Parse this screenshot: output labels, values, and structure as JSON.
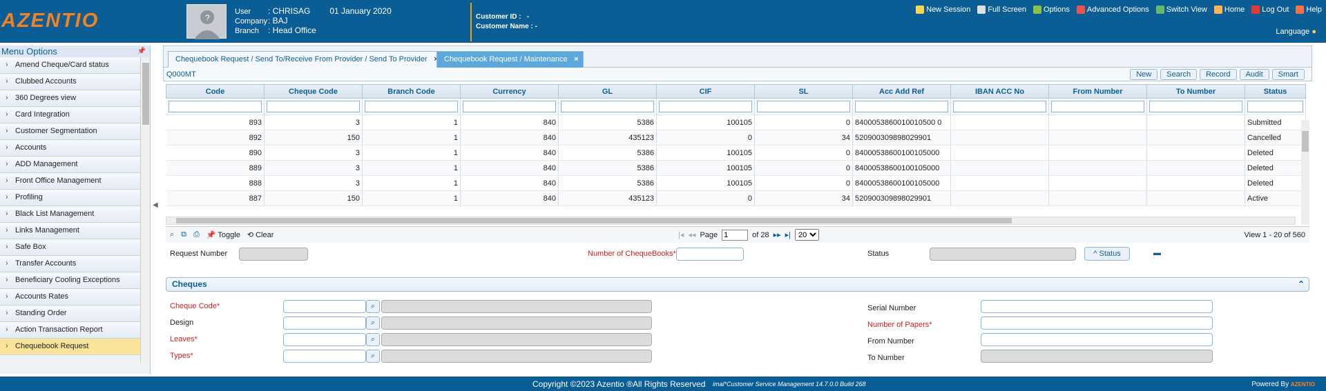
{
  "header": {
    "logo": "AZENTIO",
    "user_lbl": "User",
    "user": "CHRISAG",
    "date": "01 January 2020",
    "company_lbl": "Company",
    "company": "BAJ",
    "branch_lbl": "Branch",
    "branch": "Head Office",
    "custid_lbl": "Customer ID",
    "custid": "-",
    "custname_lbl": "Customer Name",
    "custname": "-",
    "toolbar": [
      {
        "label": "New Session",
        "icon": "new-session-icon",
        "color": "#ffd54f"
      },
      {
        "label": "Full Screen",
        "icon": "fullscreen-icon",
        "color": "#e0e0e0"
      },
      {
        "label": "Options",
        "icon": "options-icon",
        "color": "#8bc34a"
      },
      {
        "label": "Advanced Options",
        "icon": "advanced-options-icon",
        "color": "#ef5350"
      },
      {
        "label": "Switch View",
        "icon": "switch-view-icon",
        "color": "#66bb6a"
      },
      {
        "label": "Home",
        "icon": "home-icon",
        "color": "#ffb74d"
      },
      {
        "label": "Log Out",
        "icon": "logout-icon",
        "color": "#e53935"
      },
      {
        "label": "Help",
        "icon": "help-icon",
        "color": "#ff7043"
      }
    ],
    "language": "Language"
  },
  "sidebar": {
    "title": "Menu Options",
    "items": [
      "Amend Cheque/Card status",
      "Clubbed Accounts",
      "360 Degrees view",
      "Card Integration",
      "Customer Segmentation",
      "Accounts",
      "ADD Management",
      "Front Office Management",
      "Profiling",
      "Black List Management",
      "Links Management",
      "Safe Box",
      "Transfer Accounts",
      "Beneficiary Cooling Exceptions",
      "Accounts Rates",
      "Standing Order",
      "Action Transaction Report",
      "Chequebook Request"
    ]
  },
  "tabs": [
    "Chequebook Request / Send To/Receive From Provider / Send To Provider",
    "Chequebook Request / Maintenance"
  ],
  "grid": {
    "id": "Q000MT",
    "buttons": [
      "New",
      "Search",
      "Record",
      "Audit",
      "Smart"
    ],
    "columns": [
      "Code",
      "Cheque Code",
      "Branch Code",
      "Currency",
      "GL",
      "CIF",
      "SL",
      "Acc Add Ref",
      "IBAN ACC No",
      "From Number",
      "To Number",
      "Status"
    ],
    "rows": [
      [
        "893",
        "3",
        "1",
        "840",
        "5386",
        "100105",
        "0",
        "8400053860010010500 0",
        "",
        "",
        "",
        "Submitted"
      ],
      [
        "892",
        "150",
        "1",
        "840",
        "435123",
        "0",
        "34",
        "520900309898029901",
        "",
        "",
        "",
        "Cancelled"
      ],
      [
        "890",
        "3",
        "1",
        "840",
        "5386",
        "100105",
        "0",
        "84000538600100105000",
        "",
        "",
        "",
        "Deleted"
      ],
      [
        "889",
        "3",
        "1",
        "840",
        "5386",
        "100105",
        "0",
        "84000538600100105000",
        "",
        "",
        "",
        "Deleted"
      ],
      [
        "888",
        "3",
        "1",
        "840",
        "5386",
        "100105",
        "0",
        "84000538600100105000",
        "",
        "",
        "",
        "Deleted"
      ],
      [
        "887",
        "150",
        "1",
        "840",
        "435123",
        "0",
        "34",
        "520900309898029901",
        "",
        "",
        "",
        "Active"
      ]
    ]
  },
  "pager": {
    "toggle": "Toggle",
    "clear": "Clear",
    "page_lbl": "Page",
    "page": "1",
    "of": "of 28",
    "size": "20",
    "view": "View 1 - 20 of 560"
  },
  "form": {
    "request_number": "Request Number",
    "num_cheque_books": "Number of ChequeBooks*",
    "status": "Status",
    "status_btn": "Status",
    "section": "Cheques",
    "cheque_code": "Cheque Code*",
    "design": "Design",
    "leaves": "Leaves*",
    "types": "Types*",
    "serial_number": "Serial Number",
    "number_of_papers": "Number of Papers*",
    "from_number": "From Number",
    "to_number": "To Number"
  },
  "footer": {
    "copyright": "Copyright ©2023 Azentio ®All Rights Reserved",
    "build": "imal*Customer Service Management 14.7.0.0 Build 268",
    "powered": "Powered By",
    "brand": "AZENTIO"
  }
}
